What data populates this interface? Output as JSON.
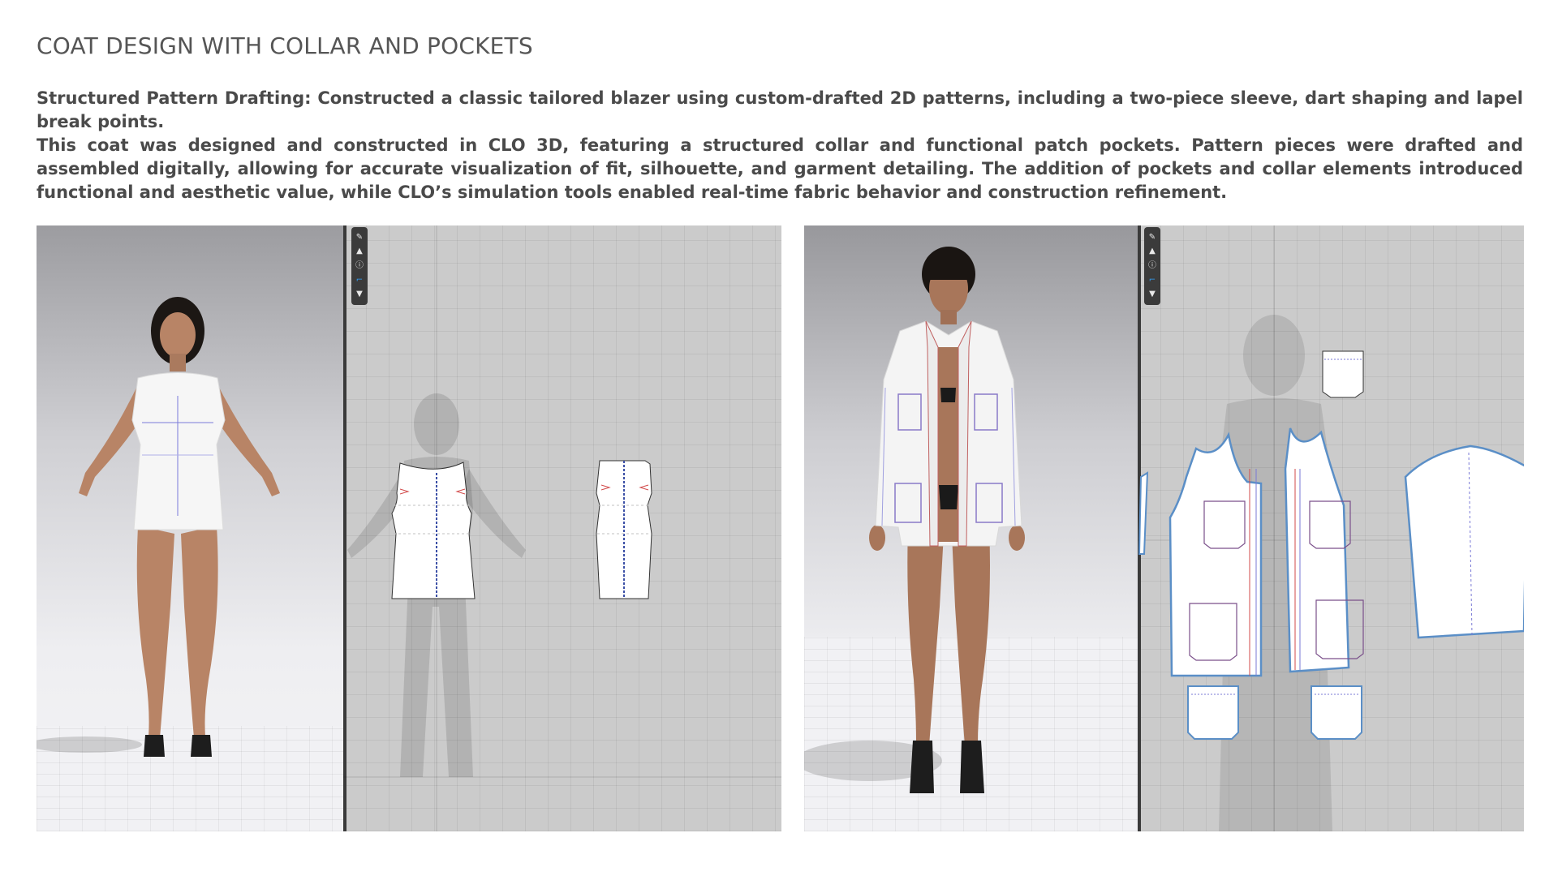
{
  "header": {
    "title": "COAT DESIGN WITH COLLAR AND POCKETS"
  },
  "description": {
    "paragraph1": "Structured Pattern Drafting: Constructed a classic tailored blazer using custom-drafted 2D patterns, including a two-piece sleeve, dart shaping and lapel break points.",
    "paragraph2": "This coat was designed and constructed in CLO 3D, featuring a structured collar and functional patch pockets. Pattern pieces were drafted and assembled digitally, allowing for accurate visualization of fit, silhouette, and garment detailing. The addition of pockets and collar elements introduced functional and aesthetic value, while CLO’s simulation tools enabled real-time fabric behavior and construction refinement."
  },
  "toolbar_icons": [
    "pencil-icon",
    "shirt-icon",
    "info-icon",
    "hanger-icon",
    "tshirt-icon"
  ],
  "colors": {
    "background": "#ffffff",
    "panel_2d_bg": "#cbcbcb",
    "toolbar_bg": "#3b3b3b",
    "pattern_outline_blue": "#5b8fc7",
    "seam_red": "#d24a4a",
    "seam_blue": "#7a7ad6",
    "skin": "#b88466"
  }
}
